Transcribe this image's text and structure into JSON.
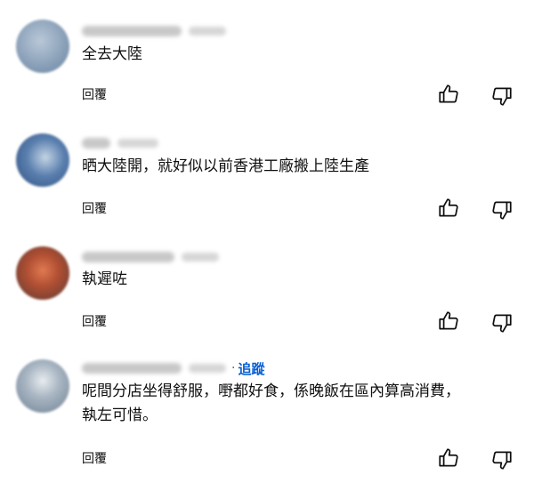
{
  "comments": [
    {
      "text": "全去大陸",
      "reply_label": "回覆",
      "avatar_colors": [
        "#8ea9c6",
        "#c7d2dc"
      ]
    },
    {
      "text": "晒大陸開，就好似以前香港工廠搬上陸生產",
      "reply_label": "回覆",
      "avatar_colors": [
        "#3c5f8f",
        "#a8c0d8"
      ]
    },
    {
      "text": "執遲咗",
      "reply_label": "回覆",
      "avatar_colors": [
        "#c05a3a",
        "#6b3a2e"
      ]
    },
    {
      "text": "呢間分店坐得舒服，嘢都好食，係晚飯在區內算高消費，\n執左可惜。",
      "reply_label": "回覆",
      "follow_label": "追蹤",
      "avatar_colors": [
        "#8fa4b8",
        "#d8dde3"
      ]
    }
  ]
}
